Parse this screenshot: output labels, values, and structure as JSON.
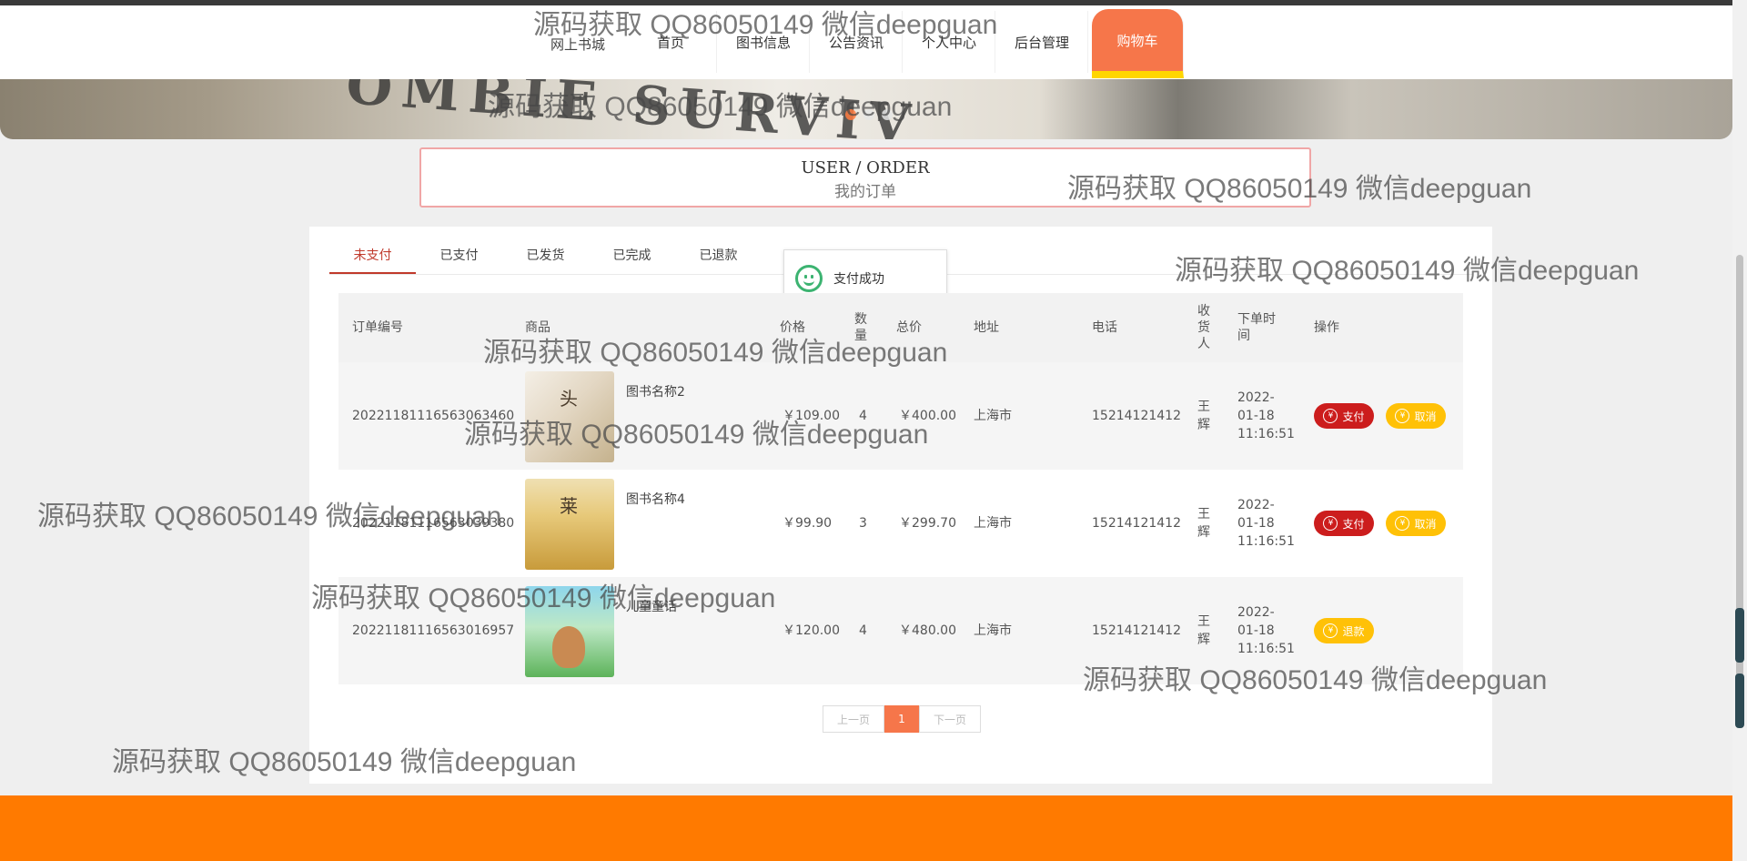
{
  "nav": {
    "logo": "网上书城",
    "items": [
      "首页",
      "图书信息",
      "公告资讯",
      "个人中心",
      "后台管理"
    ],
    "cart": "购物车"
  },
  "banner": {
    "text": "OMBIE SURVIV"
  },
  "title": {
    "en": "USER / ORDER",
    "cn": "我的订单"
  },
  "tabs": [
    "未支付",
    "已支付",
    "已发货",
    "已完成",
    "已退款"
  ],
  "active_tab": "未支付",
  "toast": "支付成功",
  "table": {
    "headers": {
      "order_no": "订单编号",
      "goods": "商品",
      "price": "价格",
      "qty": "数量",
      "total": "总价",
      "address": "地址",
      "phone": "电话",
      "receiver": "收货人",
      "time": "下单时间",
      "ops": "操作"
    },
    "rows": [
      {
        "order_no": "20221181116563063460",
        "name": "图书名称2",
        "price": "￥109.00",
        "qty": "4",
        "total": "￥400.00",
        "address": "上海市",
        "phone": "15214121412",
        "receiver": "王辉",
        "time": "2022-01-18 11:16:51",
        "pay": "支付",
        "cancel": "取消"
      },
      {
        "order_no": "20221181116563039380",
        "name": "图书名称4",
        "price": "￥99.90",
        "qty": "3",
        "total": "￥299.70",
        "address": "上海市",
        "phone": "15214121412",
        "receiver": "王辉",
        "time": "2022-01-18 11:16:51",
        "pay": "支付",
        "cancel": "取消"
      },
      {
        "order_no": "20221181116563016957",
        "name": "儿童童话",
        "price": "￥120.00",
        "qty": "4",
        "total": "￥480.00",
        "address": "上海市",
        "phone": "15214121412",
        "receiver": "王辉",
        "time": "2022-01-18 11:16:51",
        "refund": "退款"
      }
    ]
  },
  "pager": {
    "prev": "上一页",
    "current": "1",
    "next": "下一页"
  },
  "watermark": "源码获取 QQ86050149 微信deepguan",
  "colors": {
    "accent": "#f6764a",
    "footer": "#ff7a00",
    "pay": "#cc1d1d",
    "cancel": "#ffc107"
  }
}
